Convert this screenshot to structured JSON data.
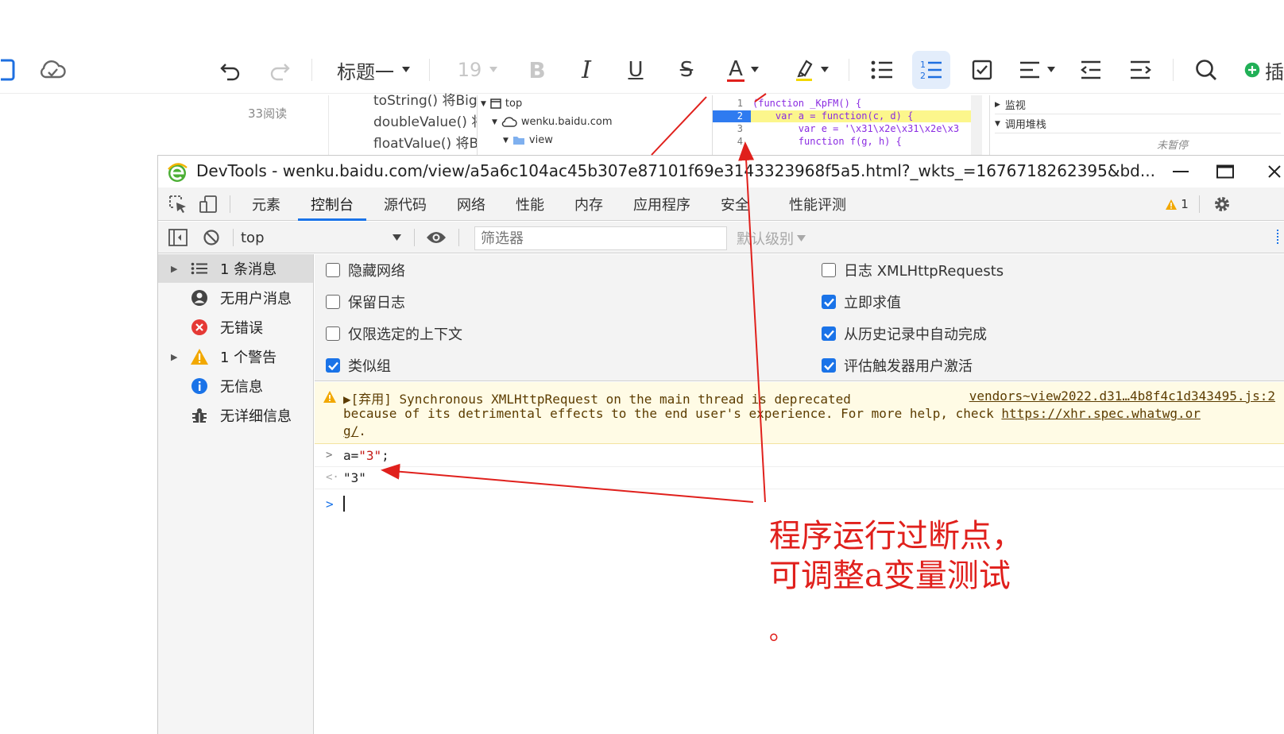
{
  "editor_toolbar": {
    "heading_style": "标题一",
    "font_size": "19",
    "bold_glyph": "B",
    "italic_glyph": "I",
    "underline_glyph": "U",
    "strike_glyph": "S",
    "font_color_glyph": "A",
    "insert_label_partial": "插",
    "accent_color": "#1e6fe0",
    "font_color_bar": "#e0201c",
    "insert_color": "#21b057"
  },
  "background_page": {
    "read_count": "33阅读",
    "code_lines": [
      "toString() 将Big",
      "doubleValue() 将",
      "floatValue() 将B"
    ],
    "tree": {
      "top": "top",
      "domain": "wenku.baidu.com",
      "folder": "view"
    },
    "source": {
      "line_numbers": [
        "1",
        "2",
        "3",
        "4"
      ],
      "lines": [
        "(function _KpFM() {",
        "    var a = function(c, d) {",
        "        var e = '\\x31\\x2e\\x31\\x2e\\x3",
        "        function f(g, h) {"
      ]
    },
    "side": {
      "watch": "监视",
      "call_stack": "调用堆栈",
      "paused": "未暂停"
    }
  },
  "devtools": {
    "window_title": "DevTools - wenku.baidu.com/view/a5a6c104ac45b307e87101f69e3143323968f5a5.html?_wkts_=1676718262395&bd...",
    "tabs": [
      "元素",
      "控制台",
      "源代码",
      "网络",
      "性能",
      "内存",
      "应用程序",
      "安全",
      "性能评测"
    ],
    "active_tab": "控制台",
    "warning_count": "1",
    "filter": {
      "context": "top",
      "placeholder": "筛选器",
      "level": "默认级别"
    },
    "sidebar": [
      {
        "label": "1 条消息",
        "icon": "list-icon",
        "expandable": true,
        "selected": true
      },
      {
        "label": "无用户消息",
        "icon": "user-icon",
        "expandable": false,
        "selected": false
      },
      {
        "label": "无错误",
        "icon": "error-icon",
        "expandable": false,
        "selected": false
      },
      {
        "label": "1 个警告",
        "icon": "warning-icon",
        "expandable": true,
        "selected": false
      },
      {
        "label": "无信息",
        "icon": "info-icon",
        "expandable": false,
        "selected": false
      },
      {
        "label": "无详细信息",
        "icon": "bug-icon",
        "expandable": false,
        "selected": false
      }
    ],
    "settings": {
      "left": [
        {
          "label": "隐藏网络",
          "checked": false
        },
        {
          "label": "保留日志",
          "checked": false
        },
        {
          "label": "仅限选定的上下文",
          "checked": false
        },
        {
          "label": "类似组",
          "checked": true
        }
      ],
      "right": [
        {
          "label": "日志 XMLHttpRequests",
          "checked": false
        },
        {
          "label": "立即求值",
          "checked": true
        },
        {
          "label": "从历史记录中自动完成",
          "checked": true
        },
        {
          "label": "评估触发器用户激活",
          "checked": true
        }
      ]
    },
    "warning_message": {
      "line1": "▶[弃用] Synchronous XMLHttpRequest on the main thread is deprecated",
      "source": "vendors~view2022.d31…4b8f4c1d343495.js:2",
      "line2_text": "because of its detrimental effects to the end user's experience. For more help, check ",
      "line2_link": "https://xhr.spec.whatwg.or",
      "line3_link": "g/",
      "line3_tail": "."
    },
    "console": {
      "input_prefix": "a=",
      "input_string": "\"3\"",
      "input_suffix": ";",
      "output": "\"3\""
    }
  },
  "annotation": {
    "line1": "程序运行过断点，",
    "line2": "可调整a变量测试",
    "dot": "。",
    "color": "#e0201c"
  }
}
